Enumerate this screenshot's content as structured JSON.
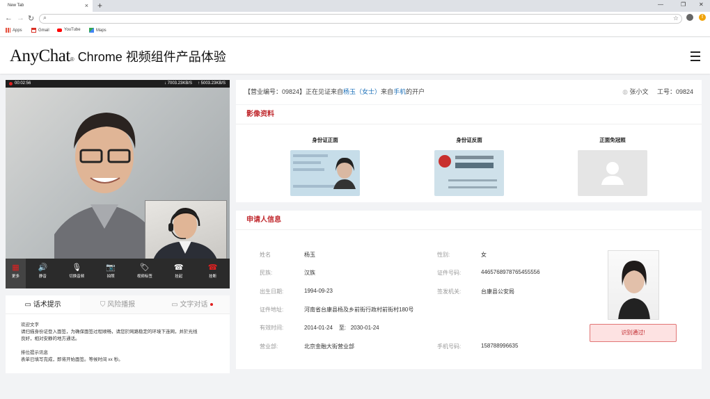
{
  "browser": {
    "tab_title": "New Tab",
    "tab_close": "×",
    "new_tab": "+",
    "window_controls": [
      "—",
      "❐",
      "✕"
    ],
    "bookmarks": [
      {
        "label": "Apps",
        "icon": "apps-grid-icon",
        "color": "#e54f3c"
      },
      {
        "label": "Gmail",
        "icon": "gmail-icon",
        "color": "#d93025"
      },
      {
        "label": "YouTube",
        "icon": "youtube-icon",
        "color": "#ff0000"
      },
      {
        "label": "Maps",
        "icon": "maps-icon",
        "color": "#34a853"
      }
    ]
  },
  "app": {
    "brand_logo": "AnyChat",
    "brand_reg": "®",
    "brand_subtitle": "Chrome 视频组件产品体验"
  },
  "video": {
    "timer": "00:02:56",
    "down_rate": "↓ 7003.23KB/S",
    "up_rate": "↑ 5003.23KB/S",
    "controls": [
      {
        "label": "更多",
        "icon": "grid-more-icon",
        "glyph": "▦"
      },
      {
        "label": "静音",
        "icon": "speaker-icon",
        "glyph": "🔊"
      },
      {
        "label": "切换音频",
        "icon": "mic-switch-icon",
        "glyph": "🎙"
      },
      {
        "label": "拍照",
        "icon": "camera-icon",
        "glyph": "📷"
      },
      {
        "label": "视频标签",
        "icon": "tag-icon",
        "glyph": "🏷"
      },
      {
        "label": "挂起",
        "icon": "phone-hold-icon",
        "glyph": "☎"
      },
      {
        "label": "挂断",
        "icon": "hangup-icon",
        "glyph": "☎"
      }
    ]
  },
  "chat": {
    "tabs": [
      {
        "label": "话术提示",
        "icon": "message-icon"
      },
      {
        "label": "风险播报",
        "icon": "shield-icon"
      },
      {
        "label": "文字对话",
        "icon": "chat-icon"
      }
    ],
    "lines": [
      "欢迎文字",
      "请扫描身份证登入面签，为确保面签过程顺畅，请您於网路稳定的环境下连网，并於光线",
      "良好，相对安静的地方通话。",
      "",
      "排位提示讯息",
      "表单已填写完成，即将开始面签。等候时间 xx 秒。"
    ]
  },
  "info_bar": {
    "prefix": "【营业编号：09824】正在见证来自",
    "name": "杨玉（女士）",
    "mid": "来自",
    "device": "手机",
    "suffix": "的开户",
    "agent": "张小文",
    "agent_id": "工号：09824"
  },
  "images_section": {
    "title": "影像资料",
    "items": [
      "身份证正面",
      "身份证反面",
      "正面免冠照"
    ]
  },
  "applicant_section": {
    "title": "申请人信息",
    "fields_left": [
      {
        "label": "姓名",
        "value": "杨玉"
      },
      {
        "label": "民族:",
        "value": "汉族"
      },
      {
        "label": "出生日期:",
        "value": "1994-09-23"
      },
      {
        "label": "证件地址:",
        "value": "河南省台康县杨及乡前街行政村前街村180号"
      },
      {
        "label": "有效时间:",
        "value": "2014-01-24    至:   2030-01-24"
      },
      {
        "label": "营业部:",
        "value": "北京金融大街营业部"
      }
    ],
    "fields_right": [
      {
        "label": "性别:",
        "value": "女"
      },
      {
        "label": "证件号码:",
        "value": "4465768978765455556"
      },
      {
        "label": "签发机关:",
        "value": "台康县公安局"
      },
      {
        "label": "手机号码:",
        "value": "158788996635"
      }
    ],
    "pass_label": "识别通过!"
  }
}
